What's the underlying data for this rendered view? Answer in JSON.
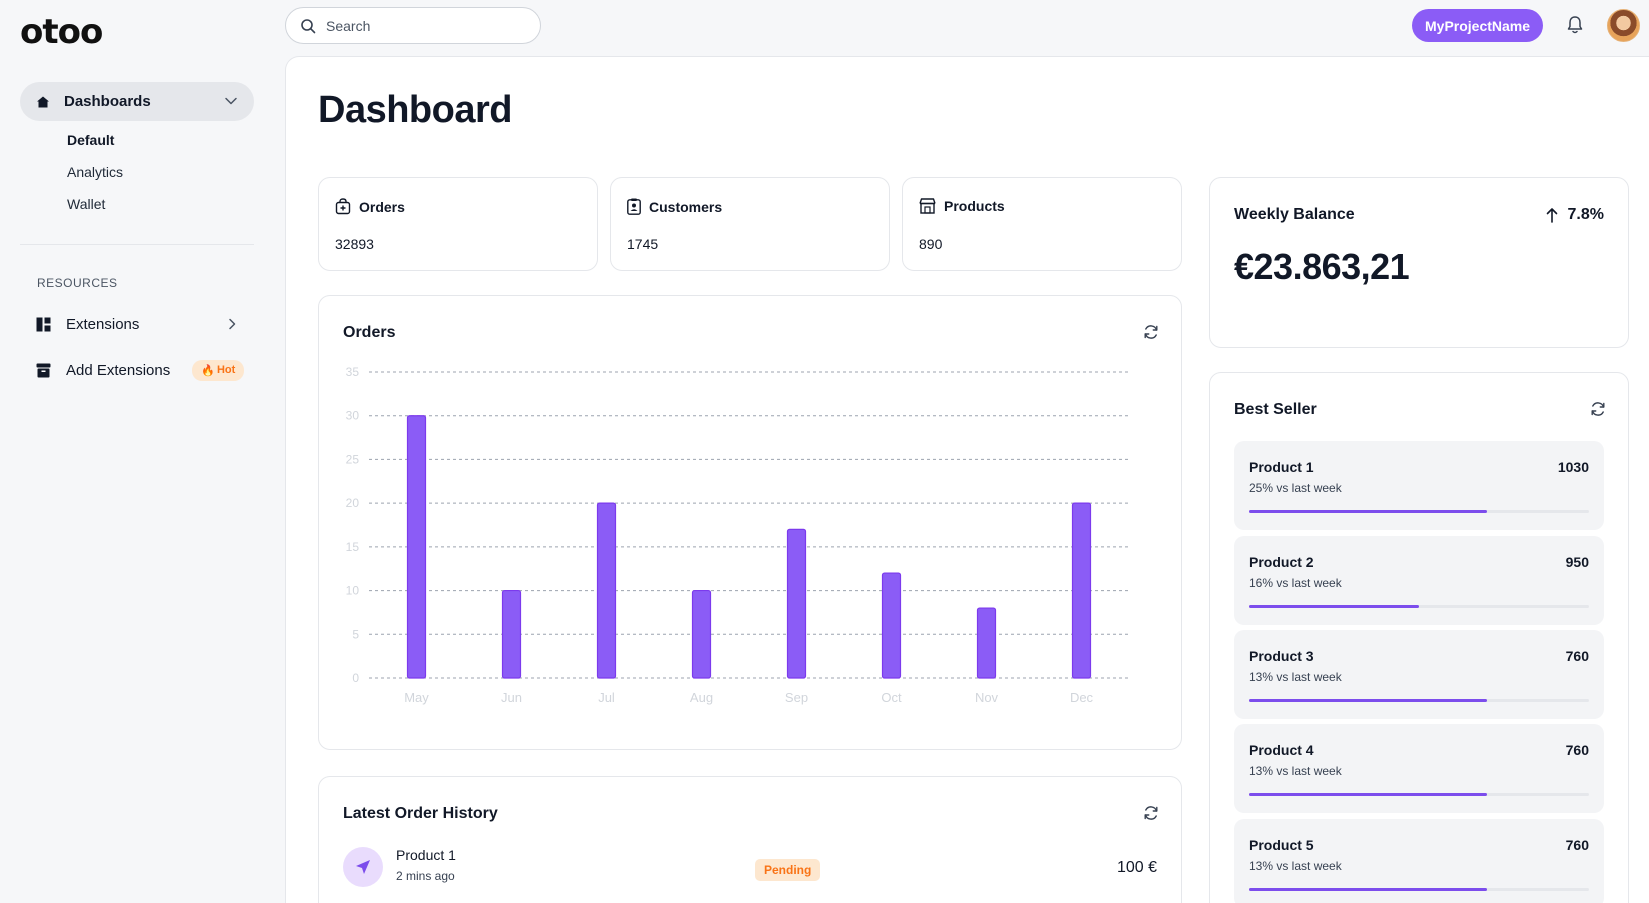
{
  "app": {
    "logo": "otoo",
    "search_placeholder": "Search",
    "project_button": "MyProjectName"
  },
  "sidebar": {
    "dashboards_label": "Dashboards",
    "sub_items": [
      "Default",
      "Analytics",
      "Wallet"
    ],
    "resources_title": "RESOURCES",
    "extensions_label": "Extensions",
    "add_extensions_label": "Add Extensions",
    "hot_badge": "Hot"
  },
  "main": {
    "title": "Dashboard",
    "stats": [
      {
        "label": "Orders",
        "value": "32893",
        "icon": "shopping-bag-icon"
      },
      {
        "label": "Customers",
        "value": "1745",
        "icon": "clipboard-user-icon"
      },
      {
        "label": "Products",
        "value": "890",
        "icon": "store-icon"
      }
    ],
    "weekly_balance": {
      "title": "Weekly Balance",
      "change": "7.8%",
      "amount": "€23.863,21"
    },
    "orders_chart_title": "Orders",
    "best_seller": {
      "title": "Best Seller",
      "items": [
        {
          "name": "Product 1",
          "value": "1030",
          "sub": "25% vs last week",
          "progress": 0.7
        },
        {
          "name": "Product 2",
          "value": "950",
          "sub": "16% vs last week",
          "progress": 0.5
        },
        {
          "name": "Product 3",
          "value": "760",
          "sub": "13% vs last week",
          "progress": 0.7
        },
        {
          "name": "Product 4",
          "value": "760",
          "sub": "13% vs last week",
          "progress": 0.7
        },
        {
          "name": "Product 5",
          "value": "760",
          "sub": "13% vs last week",
          "progress": 0.7
        }
      ]
    },
    "order_history": {
      "title": "Latest Order History",
      "rows": [
        {
          "name": "Product 1",
          "time": "2 mins ago",
          "status": "Pending",
          "price": "100 €"
        }
      ]
    }
  },
  "colors": {
    "accent": "#8b5cf6",
    "bar": "#8b5cf6",
    "hot_bg": "#fde7cf",
    "hot_text": "#f97316"
  },
  "chart_data": {
    "type": "bar",
    "title": "Orders",
    "categories": [
      "May",
      "Jun",
      "Jul",
      "Aug",
      "Sep",
      "Oct",
      "Nov",
      "Dec"
    ],
    "values": [
      30,
      10,
      20,
      10,
      17,
      12,
      8,
      20
    ],
    "yticks": [
      0,
      5,
      10,
      15,
      20,
      25,
      30,
      35
    ],
    "ylim": [
      0,
      35
    ],
    "grid": true,
    "xlabel": "",
    "ylabel": ""
  }
}
